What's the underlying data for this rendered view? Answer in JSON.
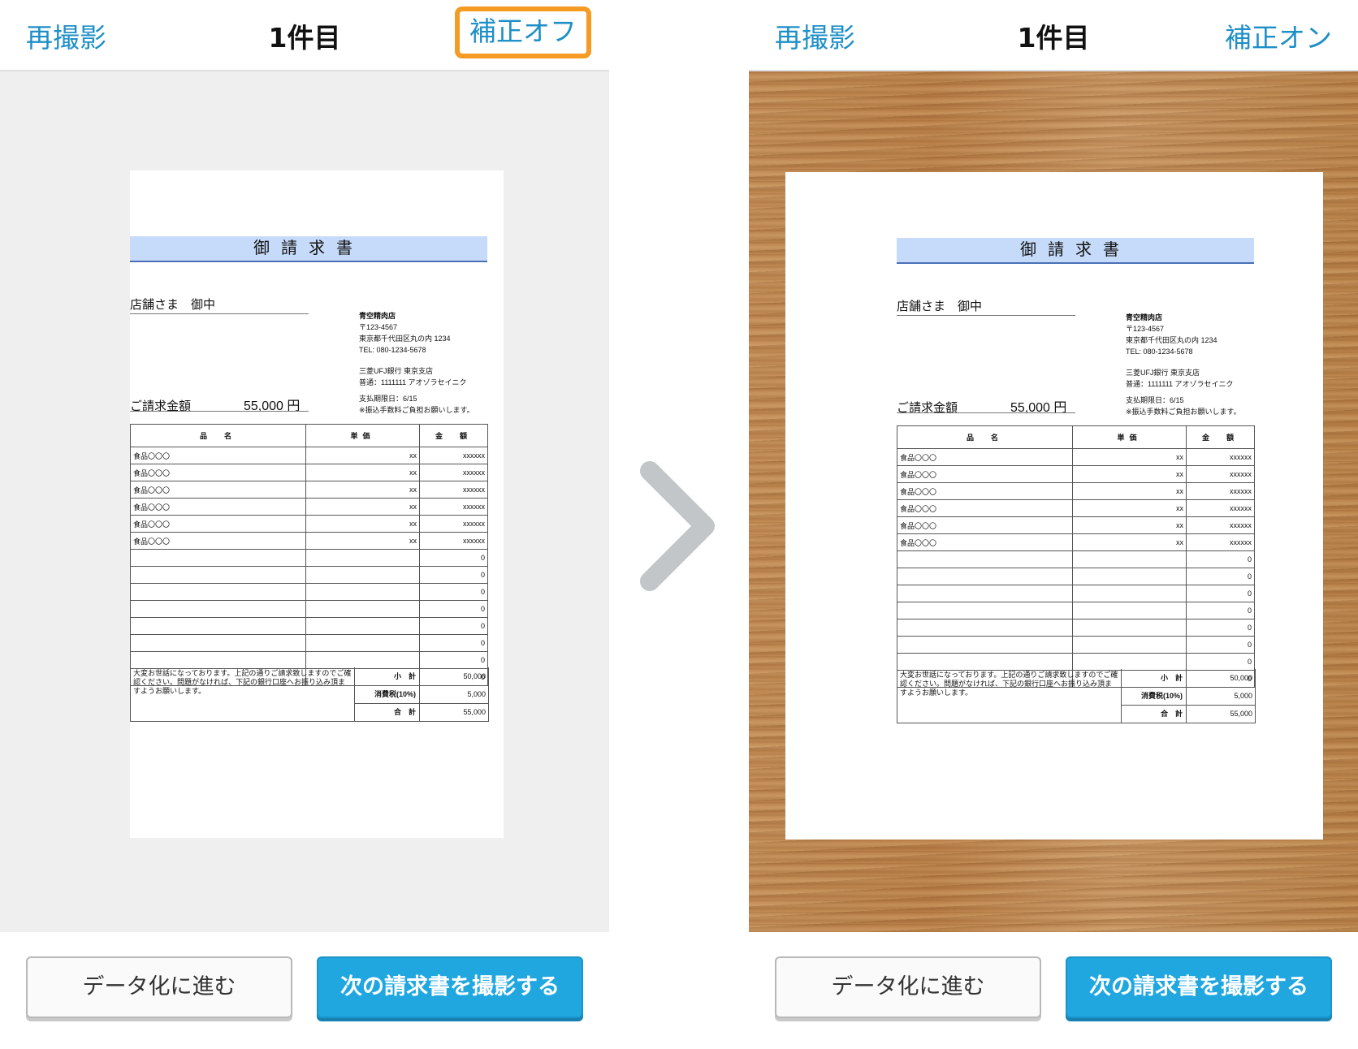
{
  "left": {
    "header": {
      "retake": "再撮影",
      "title": "1件目",
      "correction_toggle": "補正オフ"
    },
    "buttons": {
      "proceed": "データ化に進む",
      "next": "次の請求書を撮影する"
    }
  },
  "right": {
    "header": {
      "retake": "再撮影",
      "title": "1件目",
      "correction_toggle": "補正オン"
    },
    "buttons": {
      "proceed": "データ化に進む",
      "next": "次の請求書を撮影する"
    }
  },
  "invoice": {
    "title": "御請求書",
    "client": "店舗さま　御中",
    "amount_label": "ご請求金額",
    "amount_value": "55,000 円",
    "issuer": {
      "name": "青空精肉店",
      "postal": "〒123-4567",
      "address": "東京都千代田区丸の内 1234",
      "tel": "TEL: 080-1234-5678",
      "bank": "三菱UFJ銀行 東京支店",
      "account": "普通：1111111 アオゾラセイニク",
      "due": "支払期限日：6/15",
      "fee_note": "※振込手数料ご負担お願いします。"
    },
    "table": {
      "headers": [
        "品　名",
        "単価",
        "金　額"
      ],
      "rows": [
        [
          "食品〇〇〇",
          "xx",
          "xxxxxx"
        ],
        [
          "食品〇〇〇",
          "xx",
          "xxxxxx"
        ],
        [
          "食品〇〇〇",
          "xx",
          "xxxxxx"
        ],
        [
          "食品〇〇〇",
          "xx",
          "xxxxxx"
        ],
        [
          "食品〇〇〇",
          "xx",
          "xxxxxx"
        ],
        [
          "食品〇〇〇",
          "xx",
          "xxxxxx"
        ],
        [
          "",
          "",
          "0"
        ],
        [
          "",
          "",
          "0"
        ],
        [
          "",
          "",
          "0"
        ],
        [
          "",
          "",
          "0"
        ],
        [
          "",
          "",
          "0"
        ],
        [
          "",
          "",
          "0"
        ],
        [
          "",
          "",
          "0"
        ],
        [
          "",
          "",
          "0"
        ]
      ]
    },
    "note": "大変お世話になっております。上記の通りご請求致しますのでご確認ください。問題がなければ、下記の銀行口座へお振り込み頂ますようお願いします。",
    "summary": [
      {
        "label": "小　計",
        "value": "50,000"
      },
      {
        "label": "消費税(10%)",
        "value": "5,000"
      },
      {
        "label": "合　計",
        "value": "55,000"
      }
    ]
  },
  "icons": {
    "arrow": "chevron-right-icon",
    "arrow_color": "#c2c6c9"
  },
  "colors": {
    "accent": "#1e8fc7",
    "highlight": "#f59a23",
    "primary_button": "#20a7e0",
    "title_band": "#c6dbfa"
  }
}
